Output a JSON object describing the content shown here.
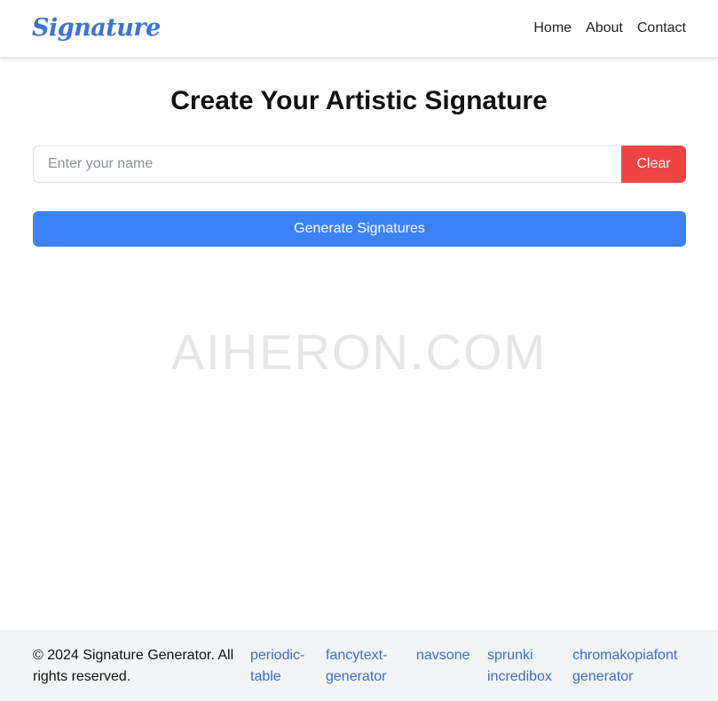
{
  "header": {
    "logo": "Signature",
    "nav": [
      "Home",
      "About",
      "Contact"
    ]
  },
  "main": {
    "title": "Create Your Artistic Signature",
    "input_placeholder": "Enter your name",
    "input_value": "",
    "clear_label": "Clear",
    "generate_label": "Generate Signatures"
  },
  "watermark": "AIHERON.COM",
  "footer": {
    "copyright": "© 2024 Signature Generator. All rights reserved.",
    "links": [
      "periodic-table",
      "fancytext-generator",
      "navsone",
      "sprunki incredibox",
      "chromakopiafont generator"
    ]
  },
  "colors": {
    "accent": "#3b82f6",
    "danger": "#ef4444",
    "logo": "#3b74d6",
    "link": "#3b6cc4",
    "footer_bg": "#f3f4f6"
  }
}
